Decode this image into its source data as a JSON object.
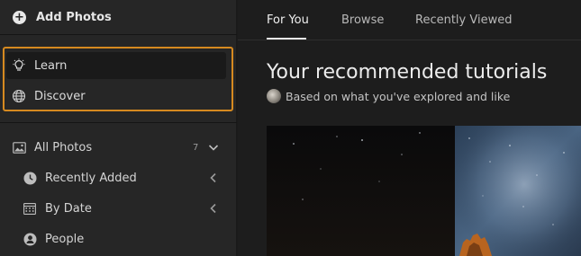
{
  "sidebar": {
    "add_photos_label": "Add Photos",
    "nav": [
      {
        "label": "Learn",
        "icon": "lightbulb-icon",
        "active": true
      },
      {
        "label": "Discover",
        "icon": "globe-icon",
        "active": false
      }
    ],
    "library": [
      {
        "label": "All Photos",
        "icon": "image-icon",
        "count": "7",
        "chevron": "down"
      },
      {
        "label": "Recently Added",
        "icon": "clock-icon",
        "chevron": "left"
      },
      {
        "label": "By Date",
        "icon": "calendar-icon",
        "chevron": "left"
      },
      {
        "label": "People",
        "icon": "person-icon"
      }
    ],
    "highlight_color": "#d68a20"
  },
  "main": {
    "tabs": [
      {
        "label": "For You",
        "active": true
      },
      {
        "label": "Browse",
        "active": false
      },
      {
        "label": "Recently Viewed",
        "active": false
      }
    ],
    "heading": "Your recommended tutorials",
    "subheading": "Based on what you've explored and like"
  }
}
